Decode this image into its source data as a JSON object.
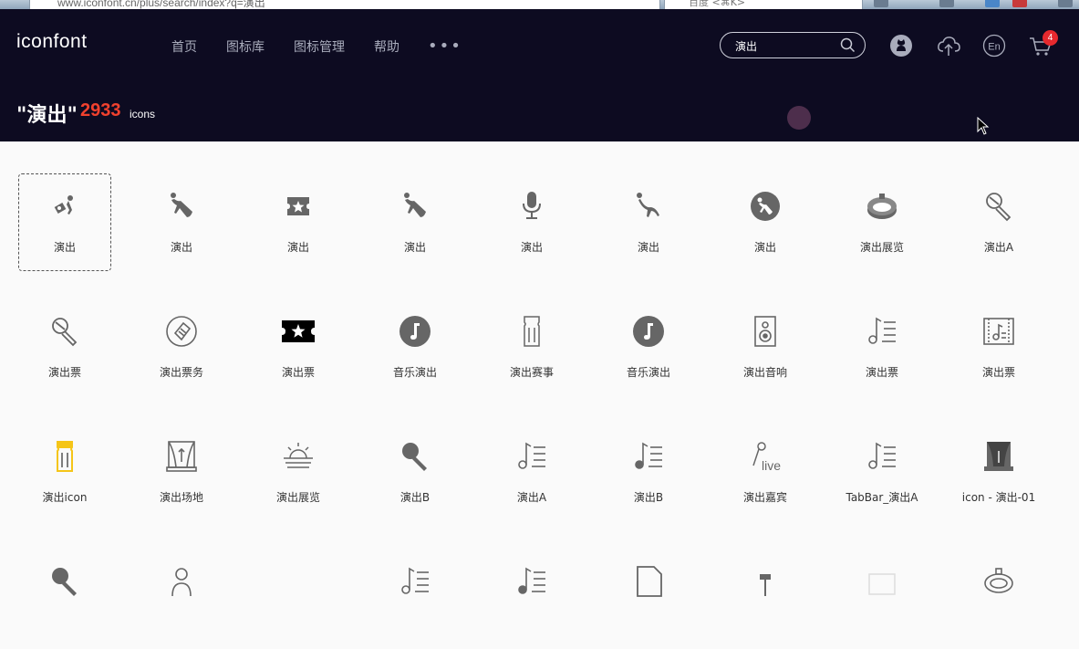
{
  "browser": {
    "url": "www.iconfont.cn/plus/search/index?q=演出",
    "search_placeholder": "百度 <⌘K>"
  },
  "header": {
    "logo": "iconfont",
    "nav": [
      {
        "label": "首页"
      },
      {
        "label": "图标库"
      },
      {
        "label": "图标管理"
      },
      {
        "label": "帮助"
      }
    ],
    "more_label": "•••",
    "search_value": "演出",
    "cart_count": "4",
    "icons": [
      "github-icon",
      "upload-cloud-icon",
      "language-en-icon",
      "cart-icon"
    ]
  },
  "query": {
    "title": "\"演出\"",
    "count": "2933",
    "unit": "icons"
  },
  "colors": {
    "header_bg": "#0d0b21",
    "accent_red": "#f0412e",
    "icon_gray": "#666666",
    "ticket_yellow": "#f5c518"
  },
  "icons": [
    {
      "label": "演出",
      "icon": "performer-dance-icon"
    },
    {
      "label": "演出",
      "icon": "dancer-ribbon-icon"
    },
    {
      "label": "演出",
      "icon": "star-ticket-icon"
    },
    {
      "label": "演出",
      "icon": "dancer-ribbon-icon"
    },
    {
      "label": "演出",
      "icon": "microphone-icon"
    },
    {
      "label": "演出",
      "icon": "dancer-figure-icon"
    },
    {
      "label": "演出",
      "icon": "dancer-circle-icon"
    },
    {
      "label": "演出展览",
      "icon": "stadium-icon"
    },
    {
      "label": "演出A",
      "icon": "microphone-outline-icon"
    },
    {
      "label": "演出票",
      "icon": "microphone-outline-icon"
    },
    {
      "label": "演出票务",
      "icon": "ticket-circle-icon"
    },
    {
      "label": "演出票",
      "icon": "star-ticket-black-icon"
    },
    {
      "label": "音乐演出",
      "icon": "music-note-circle-icon"
    },
    {
      "label": "演出赛事",
      "icon": "ticket-outline-icon"
    },
    {
      "label": "音乐演出",
      "icon": "music-note-circle-icon"
    },
    {
      "label": "演出音响",
      "icon": "speaker-icon"
    },
    {
      "label": "演出票",
      "icon": "music-list-icon"
    },
    {
      "label": "演出票",
      "icon": "music-frame-icon"
    },
    {
      "label": "演出icon",
      "icon": "ticket-yellow-icon"
    },
    {
      "label": "演出场地",
      "icon": "stage-curtain-icon"
    },
    {
      "label": "演出展览",
      "icon": "sunrise-icon"
    },
    {
      "label": "演出B",
      "icon": "microphone-solid-icon"
    },
    {
      "label": "演出A",
      "icon": "music-list-icon"
    },
    {
      "label": "演出B",
      "icon": "music-list-solid-icon"
    },
    {
      "label": "演出嘉宾",
      "icon": "live-mic-icon"
    },
    {
      "label": "TabBar_演出A",
      "icon": "music-list-icon"
    },
    {
      "label": "icon - 演出-01",
      "icon": "stage-solid-icon"
    },
    {
      "label": "",
      "icon": "microphone-solid-icon"
    },
    {
      "label": "",
      "icon": "person-outline-icon"
    },
    {
      "label": "",
      "icon": "blank-icon"
    },
    {
      "label": "",
      "icon": "music-list-icon"
    },
    {
      "label": "",
      "icon": "music-list-solid-icon"
    },
    {
      "label": "",
      "icon": "document-icon"
    },
    {
      "label": "",
      "icon": "stand-icon"
    },
    {
      "label": "",
      "icon": "faint-icon"
    },
    {
      "label": "",
      "icon": "stadium-outline-icon"
    }
  ]
}
